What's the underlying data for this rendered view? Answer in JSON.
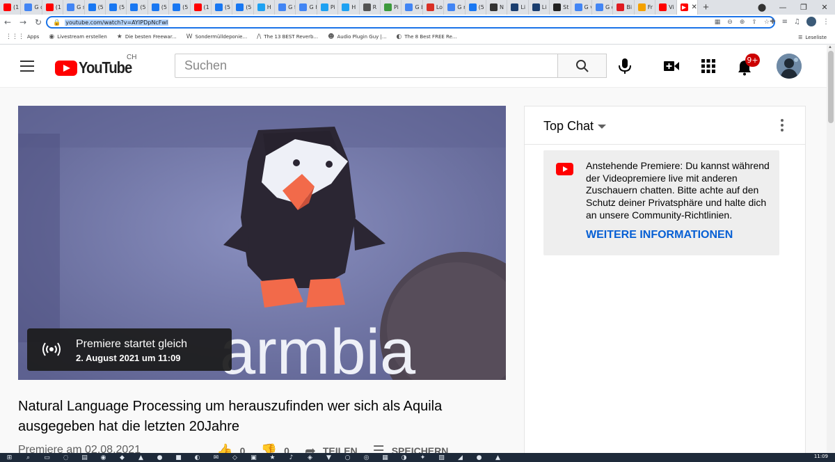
{
  "browser": {
    "tabs": [
      {
        "title": "(1",
        "color": "#ff0000"
      },
      {
        "title": "G di",
        "color": "#4285f4"
      },
      {
        "title": "(1",
        "color": "#ff0000"
      },
      {
        "title": "G si",
        "color": "#4285f4"
      },
      {
        "title": "(5",
        "color": "#1877f2"
      },
      {
        "title": "(5",
        "color": "#1877f2"
      },
      {
        "title": "(5",
        "color": "#1877f2"
      },
      {
        "title": "(5",
        "color": "#1877f2"
      },
      {
        "title": "(5",
        "color": "#1877f2"
      },
      {
        "title": "(1",
        "color": "#ff0000"
      },
      {
        "title": "(5",
        "color": "#1877f2"
      },
      {
        "title": "(5",
        "color": "#1877f2"
      },
      {
        "title": "H",
        "color": "#1da1f2"
      },
      {
        "title": "G fü",
        "color": "#4285f4"
      },
      {
        "title": "G he",
        "color": "#4285f4"
      },
      {
        "title": "Pi",
        "color": "#1da1f2"
      },
      {
        "title": "H",
        "color": "#1da1f2"
      },
      {
        "title": "R",
        "color": "#555555"
      },
      {
        "title": "Pi",
        "color": "#3c9a3c"
      },
      {
        "title": "G br",
        "color": "#4285f4"
      },
      {
        "title": "Lo",
        "color": "#d93025"
      },
      {
        "title": "G re",
        "color": "#4285f4"
      },
      {
        "title": "(5",
        "color": "#1877f2"
      },
      {
        "title": "N",
        "color": "#333333"
      },
      {
        "title": "Li",
        "color": "#1a3e6f"
      },
      {
        "title": "Li",
        "color": "#1a3e6f"
      },
      {
        "title": "St",
        "color": "#222222"
      },
      {
        "title": "G ve",
        "color": "#4285f4"
      },
      {
        "title": "G dr",
        "color": "#4285f4"
      },
      {
        "title": "Bi",
        "color": "#e01b22"
      },
      {
        "title": "Fr",
        "color": "#f4a100"
      },
      {
        "title": "Vi",
        "color": "#ff0000"
      }
    ],
    "new_tab": "+",
    "window_controls": [
      "⬤",
      "—",
      "❐",
      "✕"
    ],
    "url": "youtube.com/watch?v=AYIPDpNcFwI",
    "bookmarks": [
      {
        "icon": "⋮⋮⋮",
        "label": "Apps"
      },
      {
        "icon": "◉",
        "label": "Livestream erstellen"
      },
      {
        "icon": "★",
        "label": "Die besten Freewar..."
      },
      {
        "icon": "W",
        "label": "Sondermülldeponie..."
      },
      {
        "icon": "/\\",
        "label": "The 13 BEST Reverb..."
      },
      {
        "icon": "☻",
        "label": "Audio Plugin Guy |..."
      },
      {
        "icon": "◐",
        "label": "The 8 Best FREE Re..."
      }
    ],
    "reading_list": "Leseliste"
  },
  "youtube": {
    "country_code": "CH",
    "search_placeholder": "Suchen",
    "notification_badge": "9+",
    "video": {
      "premiere_title": "Premiere startet gleich",
      "premiere_date": "2. August 2021 um 11:09",
      "overlay_text": "armbia"
    },
    "title": "Natural Language Processing um herauszufinden wer sich als Aquila ausgegeben hat die letzten 20Jahre",
    "meta": "Premiere am 02.08.2021",
    "actions": {
      "like_count": "0",
      "dislike_count": "0",
      "share_label": "TEILEN",
      "save_label": "SPEICHERN"
    },
    "chat": {
      "mode_label": "Top Chat",
      "notice_text": "Anstehende Premiere: Du kannst während der Videopremiere live mit anderen Zuschauern chatten. Bitte achte auf den Schutz deiner Privatsphäre und halte dich an unsere Community-Richtlinien.",
      "notice_link": "WEITERE INFORMATIONEN"
    }
  },
  "taskbar": {
    "clock": "11:09"
  }
}
